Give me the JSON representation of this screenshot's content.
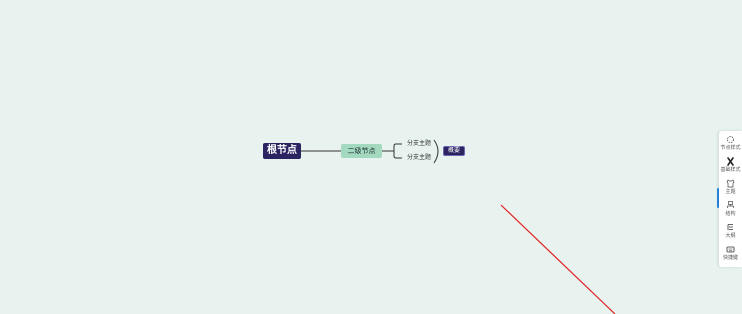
{
  "mindmap": {
    "root": "根节点",
    "second": "二级节点",
    "branches": [
      "分支主题",
      "分支主题"
    ],
    "summary": "概要"
  },
  "sidebar": {
    "items": [
      {
        "label": "节点样式",
        "icon": "node-style-icon"
      },
      {
        "label": "基础样式",
        "icon": "base-style-icon"
      },
      {
        "label": "主题",
        "icon": "theme-shirt-icon"
      },
      {
        "label": "结构",
        "icon": "structure-icon"
      },
      {
        "label": "大纲",
        "icon": "outline-icon"
      },
      {
        "label": "快捷键",
        "icon": "keyboard-icon"
      }
    ],
    "active_index": 2
  },
  "colors": {
    "background": "#e8f3ef",
    "root_fill": "#2b2460",
    "second_fill": "#a3d9bf",
    "summary_fill": "#2b2460",
    "annotation_line": "#e02020",
    "active_indicator": "#2b8ae6"
  }
}
